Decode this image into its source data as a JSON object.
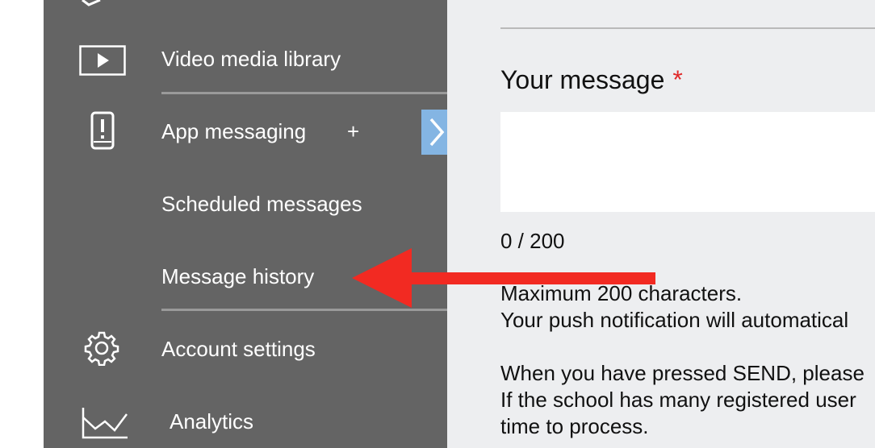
{
  "sidebar": {
    "items": [
      {
        "label": "Video media library",
        "icon": "video-play-icon"
      },
      {
        "label": "App messaging",
        "icon": "phone-alert-icon",
        "expand": "+"
      },
      {
        "label": "Scheduled messages"
      },
      {
        "label": "Message history"
      },
      {
        "label": "Account settings",
        "icon": "gear-icon"
      },
      {
        "label": "Analytics",
        "icon": "line-chart-icon"
      }
    ]
  },
  "form": {
    "message_label": "Your message",
    "required_marker": "*",
    "char_count": "0 / 200",
    "help_lines": [
      "Maximum 200 characters.",
      "Your push notification will automatical",
      "When you have pressed SEND, please",
      "If the school has many registered user",
      "time to process."
    ]
  },
  "colors": {
    "sidebar_bg": "#646464",
    "main_bg": "#edeef0",
    "accent_tab": "#84b5e3",
    "required": "#e02a2a",
    "annotation_arrow": "#f22a22"
  }
}
